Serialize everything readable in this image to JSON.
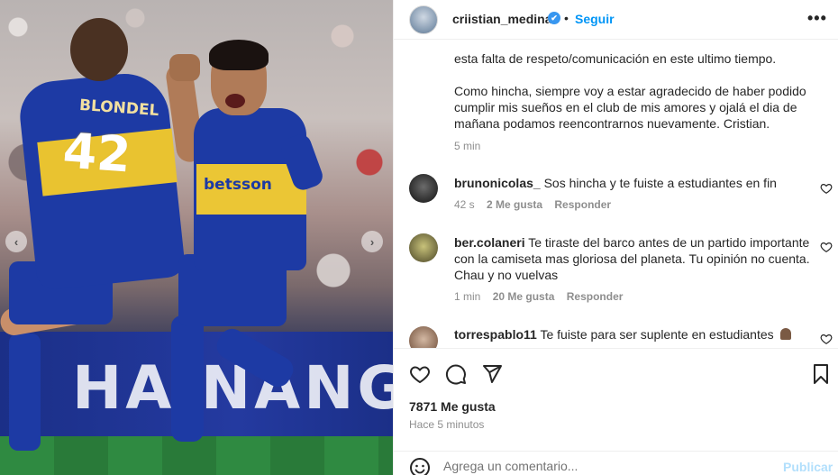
{
  "photo": {
    "ad_text": "HAINANG",
    "player1_name": "BLONDEL",
    "player1_number": "42",
    "player2_sponsor": "betsson"
  },
  "header": {
    "username": "criistian_medina",
    "verified": "✔",
    "separator": "•",
    "follow_label": "Seguir",
    "more_icon": "more-horizontal-icon"
  },
  "caption": {
    "text_partial_top": "esta falta de respeto/comunicación en este ultimo tiempo.",
    "text_paragraph": "Como hincha, siempre voy a estar agradecido de haber podido cumplir mis sueños en el club de mis amores y ojalá el dia de mañana podamos reencontrarnos nuevamente. Cristian.",
    "time": "5 min"
  },
  "comments": [
    {
      "username": "brunonicolas_",
      "text": "Sos hincha y te fuiste a estudiantes en fin",
      "time": "42 s",
      "likes": "2 Me gusta",
      "reply": "Responder"
    },
    {
      "username": "ber.colaneri",
      "text": "Te tiraste del barco antes de un partido importante con la camiseta mas gloriosa del planeta. Tu opinión no cuenta. Chau y no vuelvas",
      "time": "1 min",
      "likes": "20 Me gusta",
      "reply": "Responder"
    },
    {
      "username": "torrespablo11",
      "text": "Te fuiste para ser suplente en estudiantes"
    }
  ],
  "actions": {
    "likes": "7871 Me gusta",
    "time_ago": "Hace 5 minutos"
  },
  "comment_bar": {
    "placeholder": "Agrega un comentario...",
    "publish_label": "Publicar"
  },
  "colors": {
    "accent": "#0095f6",
    "publish_disabled": "#b2dffc",
    "muted": "#8e8e8e"
  }
}
